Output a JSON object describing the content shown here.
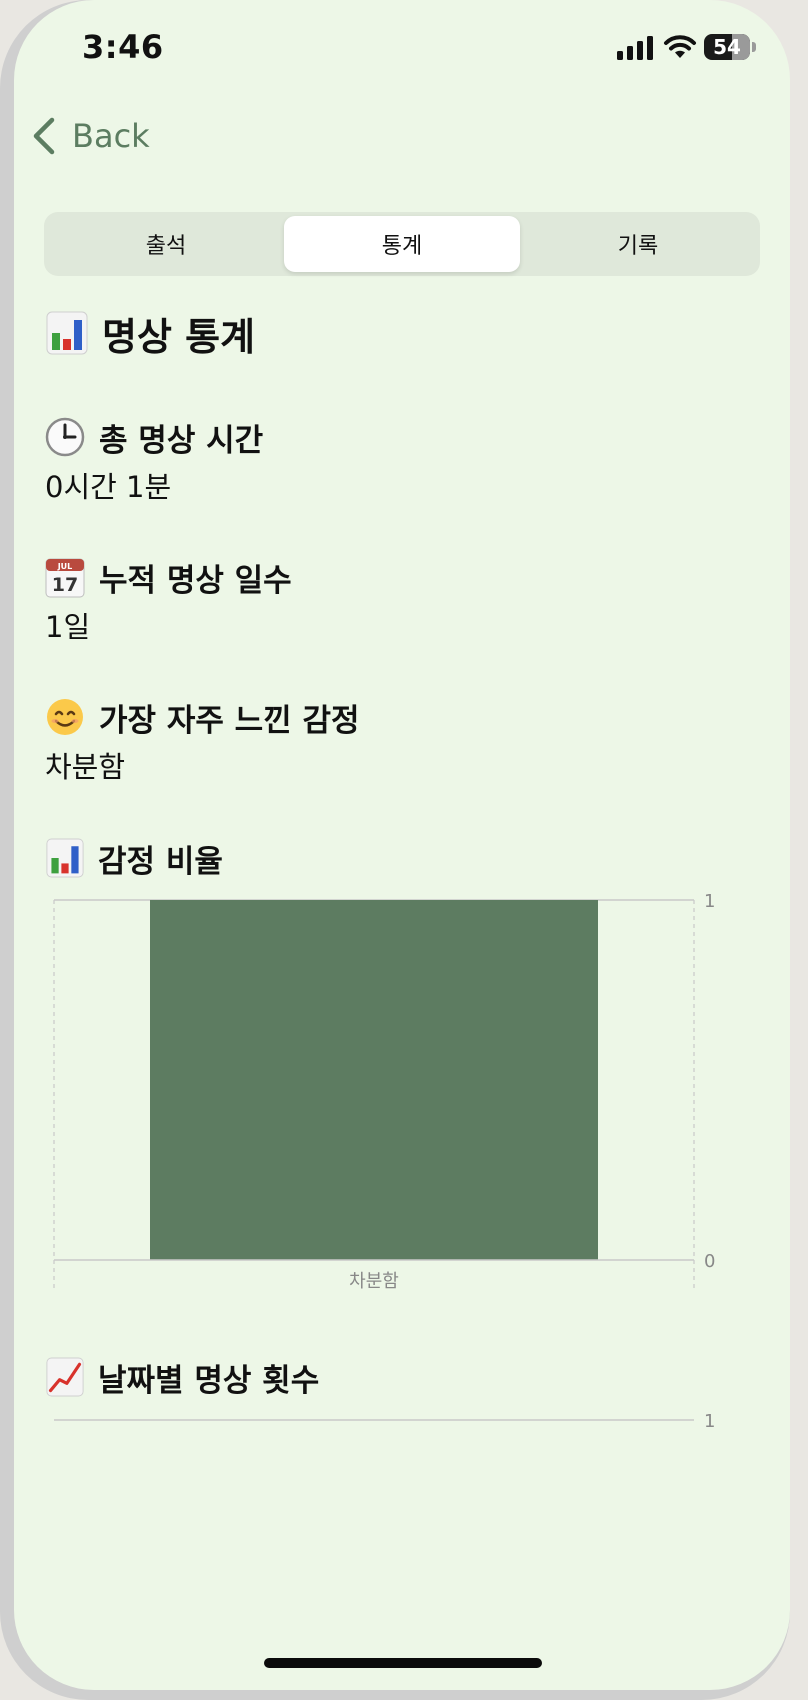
{
  "status_bar": {
    "time": "3:46",
    "battery": "54"
  },
  "nav": {
    "back_label": "Back"
  },
  "tabs": [
    {
      "label": "출석",
      "active": false
    },
    {
      "label": "통계",
      "active": true
    },
    {
      "label": "기록",
      "active": false
    }
  ],
  "page": {
    "title": "명상 통계",
    "title_icon": "bar-chart-icon"
  },
  "stats": {
    "total_time": {
      "icon": "clock-icon",
      "label": "총 명상 시간",
      "value": "0시간 1분"
    },
    "total_days": {
      "icon": "calendar-icon",
      "calendar_month": "JUL",
      "calendar_day": "17",
      "label": "누적 명상 일수",
      "value": "1일"
    },
    "top_emotion": {
      "icon": "smile-icon",
      "label": "가장 자주 느낀 감정",
      "value": "차분함"
    }
  },
  "emotion_section": {
    "icon": "bar-chart-icon",
    "title": "감정 비율"
  },
  "daily_section": {
    "icon": "line-chart-icon",
    "title": "날짜별 명상 횟수"
  },
  "chart_data": [
    {
      "type": "bar",
      "categories": [
        "차분함"
      ],
      "values": [
        1
      ],
      "ylim": [
        0,
        1
      ],
      "yticks": [
        "0",
        "1"
      ],
      "bar_color": "#5d7c61",
      "grid": true
    },
    {
      "type": "line",
      "ylim": [
        0,
        1
      ],
      "yticks": [
        "1"
      ],
      "series": []
    }
  ],
  "colors": {
    "background": "#edf7e7",
    "accent": "#5c7d61",
    "bar": "#5d7c61"
  }
}
